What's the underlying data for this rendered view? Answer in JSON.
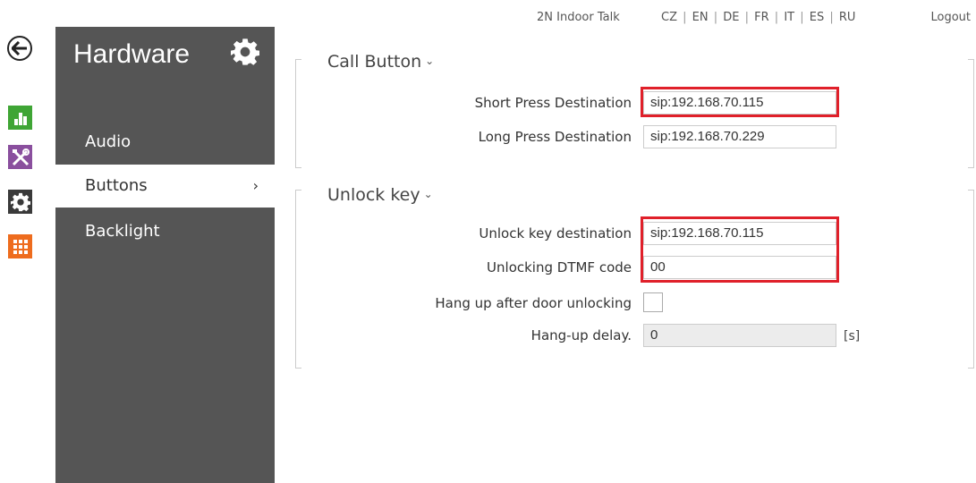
{
  "topbar": {
    "product": "2N Indoor Talk",
    "languages": [
      "CZ",
      "EN",
      "DE",
      "FR",
      "IT",
      "ES",
      "RU"
    ],
    "logout": "Logout"
  },
  "nav_icons": {
    "back": "back-arrow-icon",
    "status": "bar-chart-icon",
    "services": "tools-icon",
    "hardware": "gear-icon",
    "system": "grid-icon"
  },
  "colors": {
    "sidebar_bg": "#555555",
    "status": "#3fa535",
    "services": "#8a4f9e",
    "hardware": "#3a3a3a",
    "system": "#ee6c1e",
    "highlight": "#e0202a"
  },
  "sidebar": {
    "title": "Hardware",
    "items": [
      {
        "label": "Audio"
      },
      {
        "label": "Buttons",
        "chevron": "›"
      },
      {
        "label": "Backlight"
      }
    ]
  },
  "call_button": {
    "title": "Call Button",
    "short_press_label": "Short Press Destination",
    "short_press_value": "sip:192.168.70.115",
    "long_press_label": "Long Press Destination",
    "long_press_value": "sip:192.168.70.229"
  },
  "unlock_key": {
    "title": "Unlock key",
    "destination_label": "Unlock key destination",
    "destination_value": "sip:192.168.70.115",
    "dtmf_label": "Unlocking DTMF code",
    "dtmf_value": "00",
    "hangup_label": "Hang up after door unlocking",
    "hangup_checked": false,
    "delay_label": "Hang-up delay.",
    "delay_value": "0",
    "delay_unit": "[s]"
  }
}
